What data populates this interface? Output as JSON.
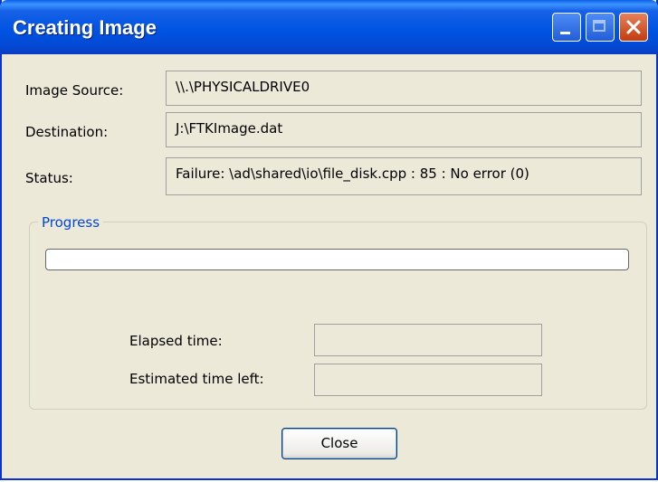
{
  "window": {
    "title": "Creating Image"
  },
  "fields": {
    "image_source_label": "Image Source:",
    "image_source_value": "\\\\.\\PHYSICALDRIVE0",
    "destination_label": "Destination:",
    "destination_value": "J:\\FTKImage.dat",
    "status_label": "Status:",
    "status_value": "Failure: \\ad\\shared\\io\\file_disk.cpp : 85 : No error (0)"
  },
  "progress": {
    "group_label": "Progress",
    "percent": 0,
    "elapsed_label": "Elapsed time:",
    "elapsed_value": "",
    "estimated_label": "Estimated time left:",
    "estimated_value": ""
  },
  "buttons": {
    "close_label": "Close"
  },
  "colors": {
    "titlebar": "#0054e3",
    "dialog_bg": "#ece9d8",
    "group_label": "#0046d5",
    "close_caption_button": "#c33c0f"
  }
}
